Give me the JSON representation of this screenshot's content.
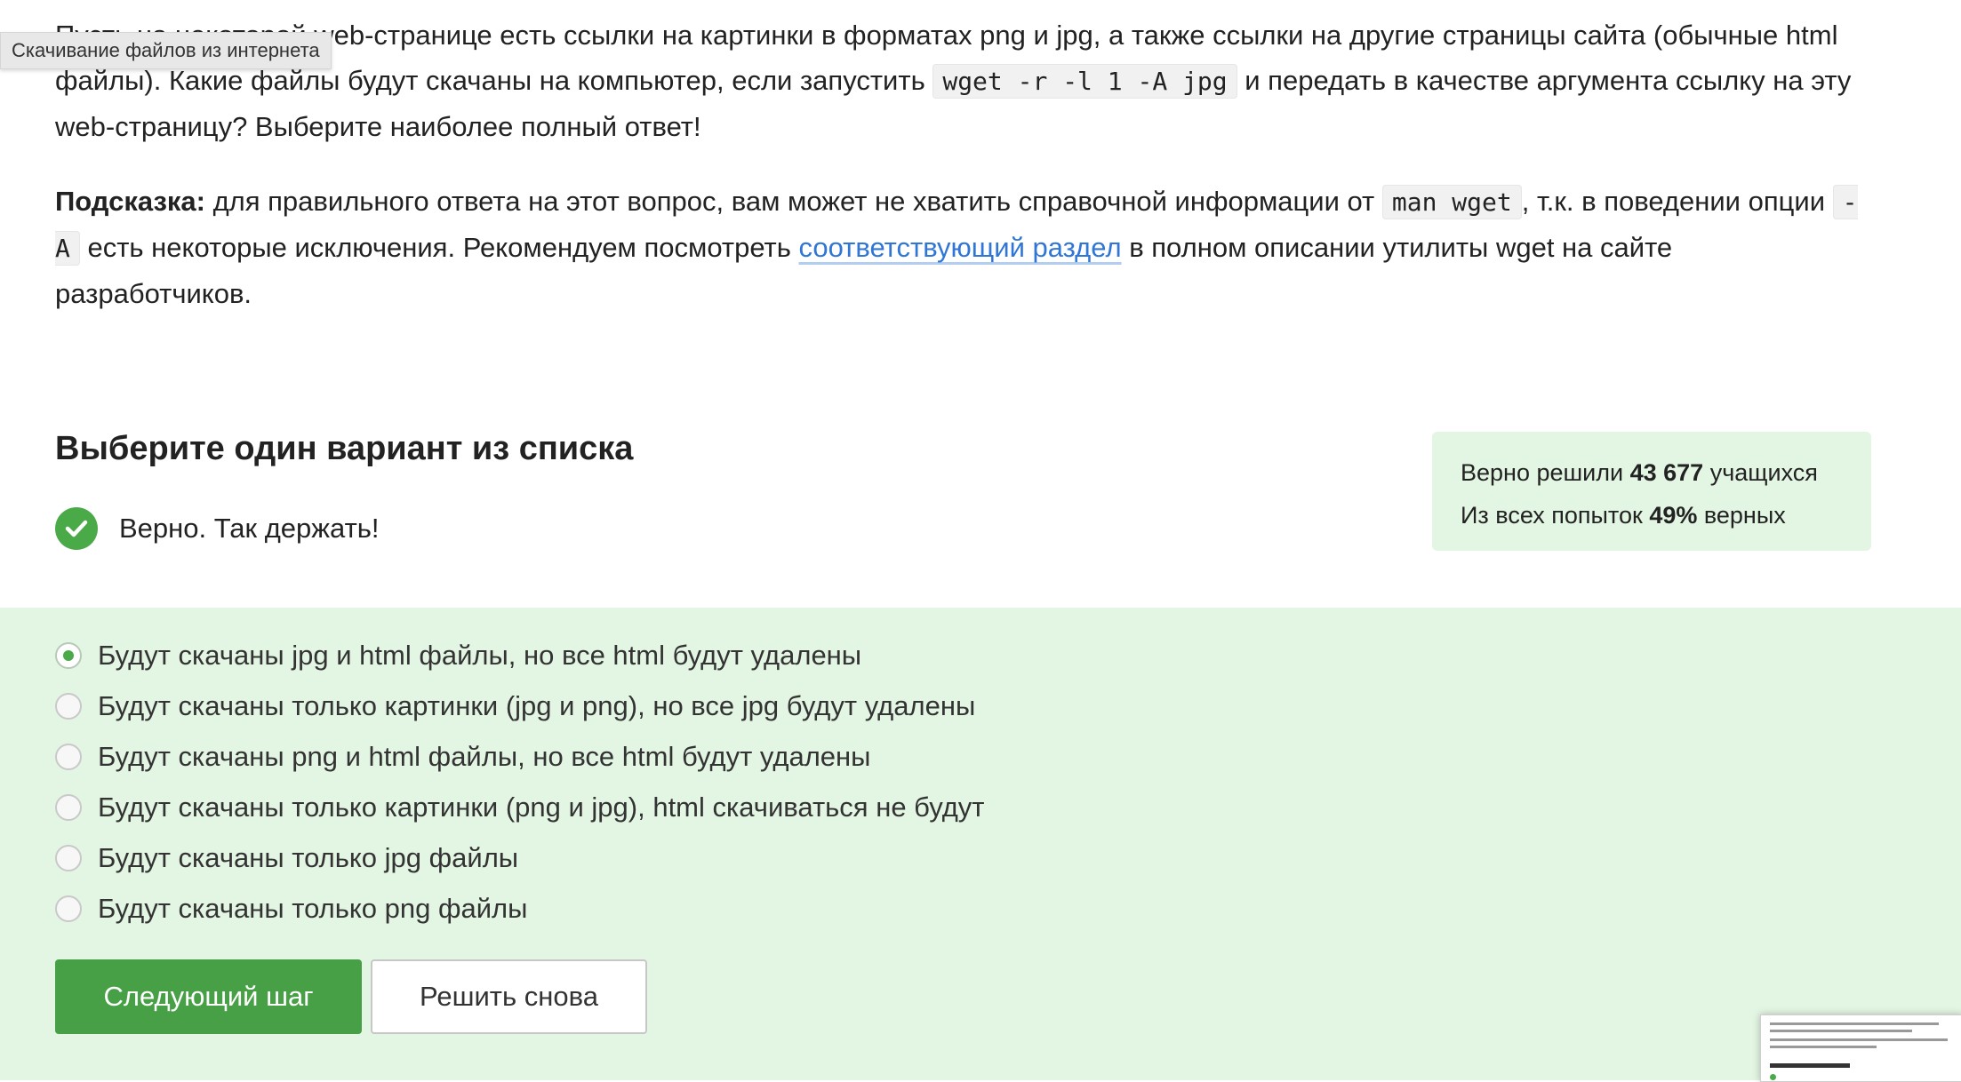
{
  "tooltip": "Скачивание файлов из интернета",
  "question": {
    "p1_part1": "Пусть на некоторой web-странице есть ссылки на картинки в форматах png и jpg, а также ссылки на другие страницы сайта (обычные html файлы). Какие файлы будут скачаны на компьютер, если запустить ",
    "p1_code": "wget -r -l 1 -A jpg",
    "p1_part2": " и передать в качестве аргумента ссылку на эту web-страницу? Выберите наиболее полный ответ!",
    "hint_label": "Подсказка:",
    "hint_part1": " для правильного ответа на этот вопрос, вам может не хватить справочной информации от ",
    "hint_code1": "man wget",
    "hint_part2": ", т.к. в поведении опции ",
    "hint_code2": "-A",
    "hint_part3": " есть некоторые исключения. Рекомендуем посмотреть ",
    "hint_link": "соответствующий раздел",
    "hint_part4": " в полном описании утилиты wget на сайте разработчиков."
  },
  "choose_title": "Выберите один вариант из списка",
  "verdict": "Верно. Так держать!",
  "stats": {
    "line1_prefix": "Верно решили ",
    "solved_count": "43 677",
    "line1_suffix": " учащихся",
    "line2_prefix": "Из всех попыток ",
    "percent": "49%",
    "line2_suffix": " верных"
  },
  "options": [
    {
      "label": "Будут скачаны jpg и html файлы, но все html будут удалены",
      "selected": true
    },
    {
      "label": "Будут скачаны только картинки (jpg и png), но все jpg будут удалены",
      "selected": false
    },
    {
      "label": "Будут скачаны png и html файлы, но все html будут удалены",
      "selected": false
    },
    {
      "label": "Будут скачаны только картинки (png и jpg), html скачиваться не будут",
      "selected": false
    },
    {
      "label": "Будут скачаны только jpg файлы",
      "selected": false
    },
    {
      "label": "Будут скачаны только png файлы",
      "selected": false
    }
  ],
  "buttons": {
    "next": "Следующий шаг",
    "retry": "Решить снова"
  },
  "colors": {
    "accent_green": "#47a046",
    "success_bg": "#e3f5e3",
    "link": "#2f76d6"
  }
}
